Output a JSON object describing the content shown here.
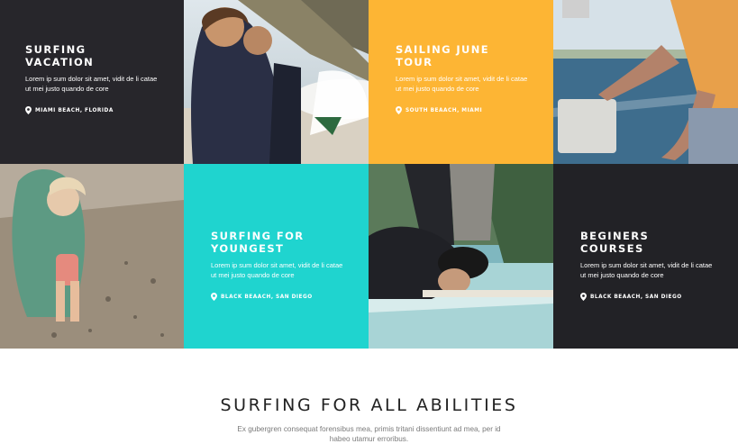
{
  "colors": {
    "dark": "#27262b",
    "orange": "#fdb534",
    "teal": "#1fd4cf",
    "dark2": "#222226"
  },
  "cards": [
    {
      "title": "SURFING VACATION",
      "text": "Lorem ip sum dolor sit amet, vidit de li catae ut mei justo quando de core",
      "location": "MIAMI BEACH, FLORIDA",
      "icon": "map-pin-icon"
    },
    {
      "title": "SAILING JUNE TOUR",
      "text": "Lorem ip sum dolor sit amet, vidit de li catae ut mei justo quando de core",
      "location": "SOUTH BEAACH, MIAMI",
      "icon": "map-pin-icon"
    },
    {
      "title": "SURFING FOR YOUNGEST",
      "text": "Lorem ip sum dolor sit amet, vidit de li catae ut mei justo quando de core",
      "location": "BLACK BEAACH, SAN DIEGO",
      "icon": "map-pin-icon"
    },
    {
      "title": "BEGINERS COURSES",
      "text": "Lorem ip sum dolor sit amet, vidit de li catae ut mei justo quando de core",
      "location": "BLACK BEAACH, SAN DIEGO",
      "icon": "map-pin-icon"
    }
  ],
  "section": {
    "title": "SURFING FOR ALL ABILITIES",
    "text": "Ex gubergren consequat forensibus mea, primis tritani dissentiunt ad mea, per id habeo utamur erroribus."
  }
}
